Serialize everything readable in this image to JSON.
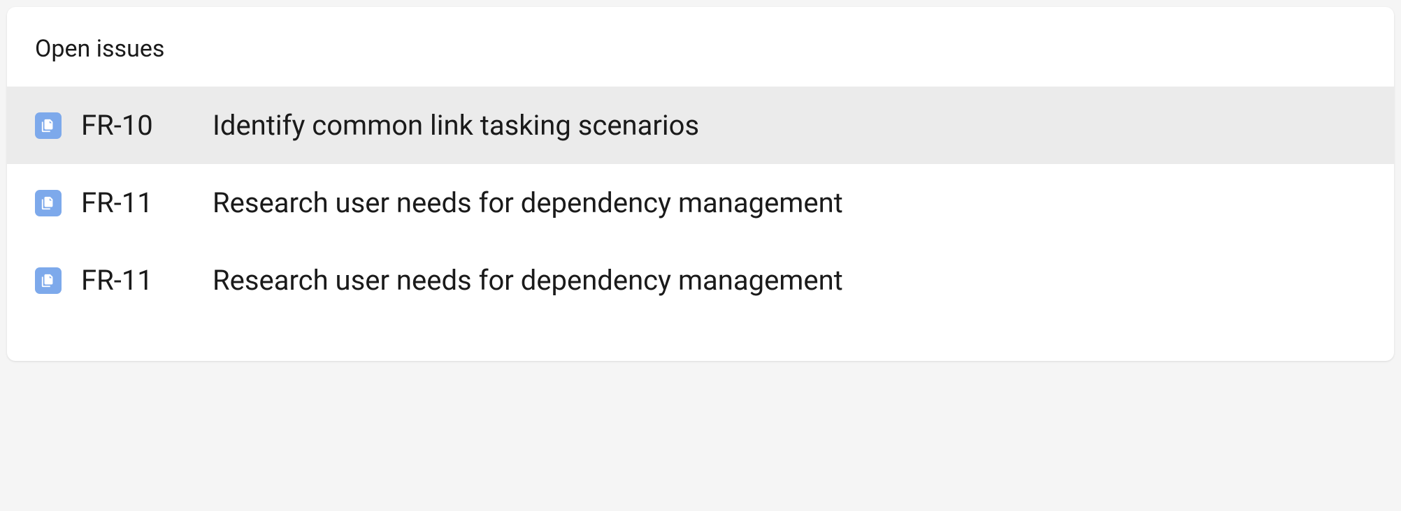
{
  "panel": {
    "title": "Open issues"
  },
  "issues": [
    {
      "key": "FR-10",
      "title": "Identify common link tasking scenarios",
      "selected": true
    },
    {
      "key": "FR-11",
      "title": "Research user needs for dependency management",
      "selected": false
    },
    {
      "key": "FR-11",
      "title": "Research user needs for dependency management",
      "selected": false
    }
  ]
}
